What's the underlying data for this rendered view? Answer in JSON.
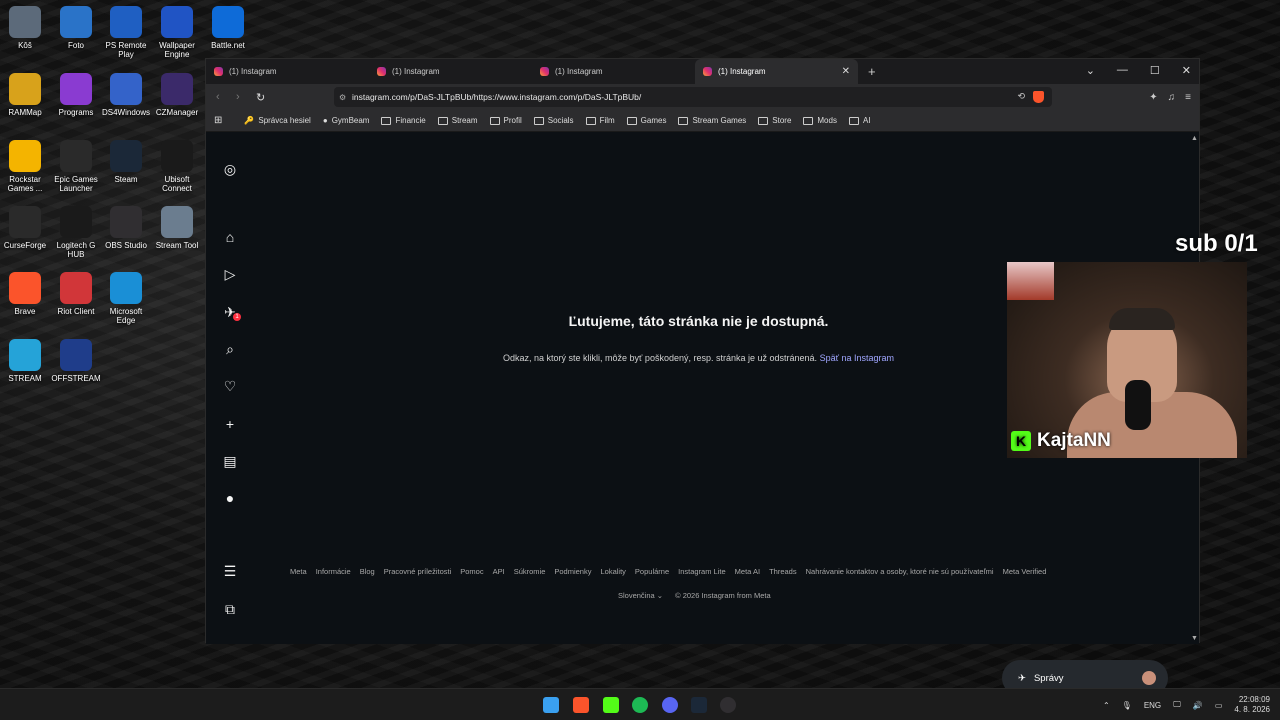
{
  "desktop": {
    "icons": [
      {
        "label": "Kôš",
        "color": "#5c6a7a"
      },
      {
        "label": "Foto",
        "color": "#2a73c8"
      },
      {
        "label": "PS Remote Play",
        "color": "#1f5fc2"
      },
      {
        "label": "Wallpaper Engine",
        "color": "#2054c4"
      },
      {
        "label": "Battle.net",
        "color": "#0e6bd8"
      },
      {
        "label": "RAMMap",
        "color": "#d8a21b"
      },
      {
        "label": "Programs",
        "color": "#8a3bd1"
      },
      {
        "label": "DS4Windows",
        "color": "#3463c9"
      },
      {
        "label": "CZManager",
        "color": "#3b2a6a"
      },
      {
        "label": "Rockstar Games ...",
        "color": "#f4b400"
      },
      {
        "label": "Epic Games Launcher",
        "color": "#2a2a2a"
      },
      {
        "label": "Steam",
        "color": "#1b2838"
      },
      {
        "label": "Ubisoft Connect",
        "color": "#1a1a1a"
      },
      {
        "label": "CurseForge",
        "color": "#2a2a2a"
      },
      {
        "label": "Logitech G HUB",
        "color": "#1a1a1a"
      },
      {
        "label": "OBS Studio",
        "color": "#302e31"
      },
      {
        "label": "Stream Tool",
        "color": "#6b7d8f"
      },
      {
        "label": "Brave",
        "color": "#fb542b"
      },
      {
        "label": "Riot Client",
        "color": "#d13639"
      },
      {
        "label": "Microsoft Edge",
        "color": "#1a8fd6"
      },
      {
        "label": "STREAM",
        "color": "#25a3d8"
      },
      {
        "label": "OFFSTREAM",
        "color": "#1f3d8a"
      }
    ]
  },
  "browser": {
    "tabs": [
      {
        "title": "(1) Instagram"
      },
      {
        "title": "(1) Instagram"
      },
      {
        "title": "(1) Instagram"
      },
      {
        "title": "(1) Instagram"
      }
    ],
    "url": "instagram.com/p/DaS-JLTpBUb/https://www.instagram.com/p/DaS-JLTpBUb/",
    "bookmarks": [
      "Správca hesiel",
      "GymBeam",
      "Financie",
      "Stream",
      "Profil",
      "Socials",
      "Film",
      "Games",
      "Stream Games",
      "Store",
      "Mods",
      "AI"
    ]
  },
  "instagram": {
    "notification_badge": "1",
    "error_title": "Ľutujeme, táto stránka nie je dostupná.",
    "error_message": "Odkaz, na ktorý ste klikli, môže byť poškodený, resp. stránka je už odstránená.",
    "back_link": "Späť na Instagram",
    "footer_links": [
      "Meta",
      "Informácie",
      "Blog",
      "Pracovné príležitosti",
      "Pomoc",
      "API",
      "Súkromie",
      "Podmienky",
      "Lokality",
      "Populárne",
      "Instagram Lite",
      "Meta AI",
      "Threads",
      "Nahrávanie kontaktov a osoby, ktoré nie sú používateľmi",
      "Meta Verified"
    ],
    "language": "Slovenčina",
    "copyright": "© 2026 Instagram from Meta",
    "messages_label": "Správy",
    "messages_badge": "1"
  },
  "overlay": {
    "sub_count": "sub 0/1",
    "streamer_name": "KajtaNN"
  },
  "taskbar": {
    "language": "ENG",
    "time": "22:08:09",
    "date": "4. 8. 2026"
  }
}
